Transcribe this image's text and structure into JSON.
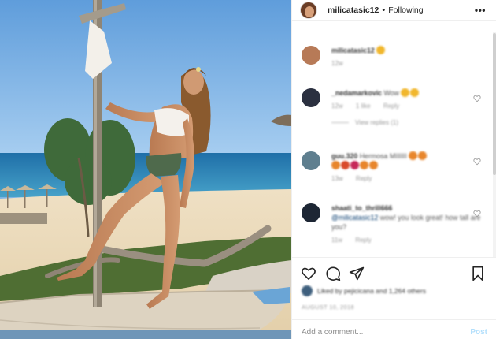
{
  "header": {
    "username": "milicatasic12",
    "separator": "•",
    "follow_status": "Following",
    "more_icon": "more-horizontal-icon"
  },
  "comments": [
    {
      "username": "milicatasic12",
      "text": "",
      "meta": [
        "12w"
      ],
      "emojis": [
        "#f1b72d"
      ],
      "avatar_color": "#b77a57"
    },
    {
      "username": "_nedamarkovic",
      "text": "Wow",
      "meta": [
        "12w",
        "1 like",
        "Reply"
      ],
      "view_replies": "View replies (1)",
      "emojis": [
        "#f1b72d",
        "#f1b72d"
      ],
      "avatar_color": "#2b3040"
    },
    {
      "username": "guu.320",
      "text": "Hermosa MIIIIII",
      "meta": [
        "13w",
        "Reply"
      ],
      "emojis": [
        "#e8862c",
        "#e8862c",
        "#d94b2b",
        "#c6285a",
        "#e8862c",
        "#e8862c",
        "#e8862c"
      ],
      "avatar_color": "#5f7f8f"
    },
    {
      "username": "shaati_to_thrill666",
      "mention": "@milicatasic12",
      "text": "wow! you look great! how tall are you?",
      "meta": [
        "11w",
        "Reply"
      ],
      "avatar_color": "#1d2634"
    }
  ],
  "actions": {
    "like_icon": "heart-icon",
    "comment_icon": "comment-icon",
    "share_icon": "share-icon",
    "save_icon": "bookmark-icon"
  },
  "likes": {
    "text": "Liked by pejicicana and 1,264 others"
  },
  "date": "AUGUST 10, 2018",
  "add_comment": {
    "placeholder": "Add a comment...",
    "post_label": "Post"
  },
  "colors": {
    "post_disabled": "#b2dffc",
    "text_primary": "#262626",
    "text_secondary": "#8e8e8e",
    "border": "#efefef"
  }
}
